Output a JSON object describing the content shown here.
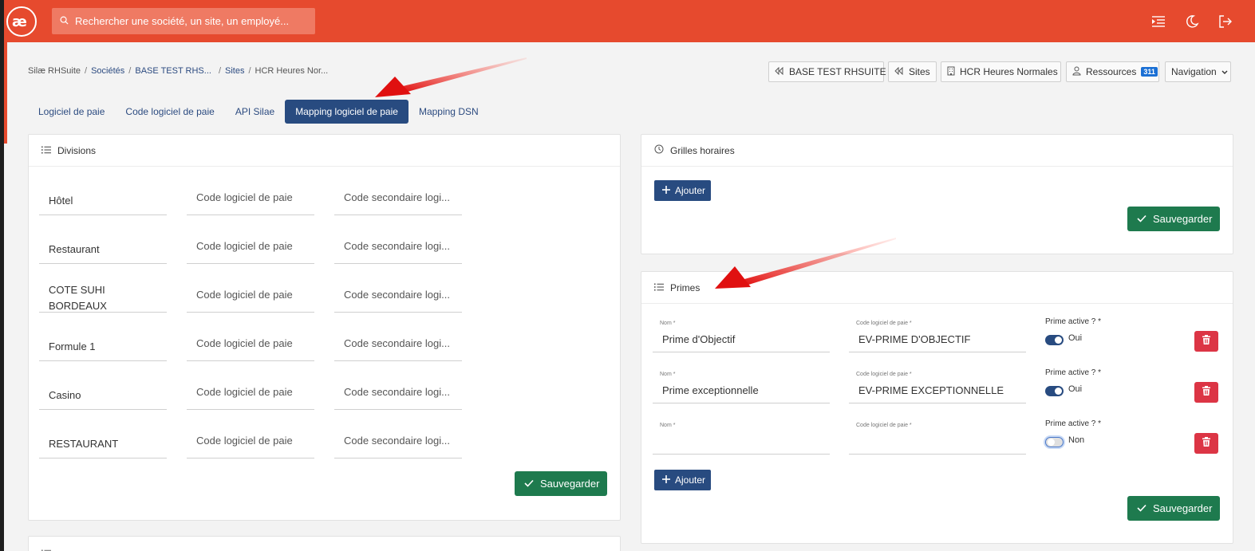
{
  "header": {
    "search_placeholder": "Rechercher une société, un site, un employé..."
  },
  "breadcrumb": {
    "items": [
      "Silæ RHSuite",
      "Sociétés",
      "BASE TEST RHS...",
      "Sites",
      "HCR Heures Nor..."
    ]
  },
  "shortcuts": {
    "company": "BASE TEST RHSUITE",
    "sites": "Sites",
    "site_name": "HCR Heures Normales",
    "resources": "Ressources",
    "resources_count": "311",
    "navigation": "Navigation"
  },
  "tabs": [
    "Logiciel de paie",
    "Code logiciel de paie",
    "API Silae",
    "Mapping logiciel de paie",
    "Mapping DSN"
  ],
  "divisions": {
    "title": "Divisions",
    "code_placeholder": "Code logiciel de paie",
    "secondary_placeholder": "Code secondaire logi...",
    "rows": [
      "Hôtel",
      "Restaurant",
      "COTE SUHI BORDEAUX",
      "Formule 1",
      "Casino",
      "RESTAURANT"
    ],
    "save_label": "Sauvegarder"
  },
  "grilles": {
    "title": "Grilles horaires",
    "add_label": "Ajouter",
    "save_label": "Sauvegarder"
  },
  "primes": {
    "title": "Primes",
    "nom_label": "Nom *",
    "code_label": "Code logiciel de paie *",
    "active_label": "Prime active ? *",
    "rows": [
      {
        "nom": "Prime d'Objectif",
        "code": "EV-PRIME D'OBJECTIF",
        "active": "Oui"
      },
      {
        "nom": "Prime exceptionnelle",
        "code": "EV-PRIME EXCEPTIONNELLE",
        "active": "Oui"
      },
      {
        "nom": "",
        "code": "",
        "active": "Non"
      }
    ],
    "add_label": "Ajouter",
    "save_label": "Sauvegarder"
  },
  "colors": {
    "brand": "#e64a2e",
    "primary": "#284b80",
    "success": "#1e7a4e",
    "danger": "#dc3545",
    "badge": "#1a6fd4"
  },
  "icons": [
    "logo-icon",
    "search-icon",
    "menu-indent-icon",
    "moon-icon",
    "logout-icon",
    "rewind-icon",
    "building-icon",
    "user-icon",
    "chevron-down-icon",
    "list-icon",
    "clock-icon",
    "plus-icon",
    "check-icon",
    "trash-icon",
    "red-arrow-annotation"
  ]
}
